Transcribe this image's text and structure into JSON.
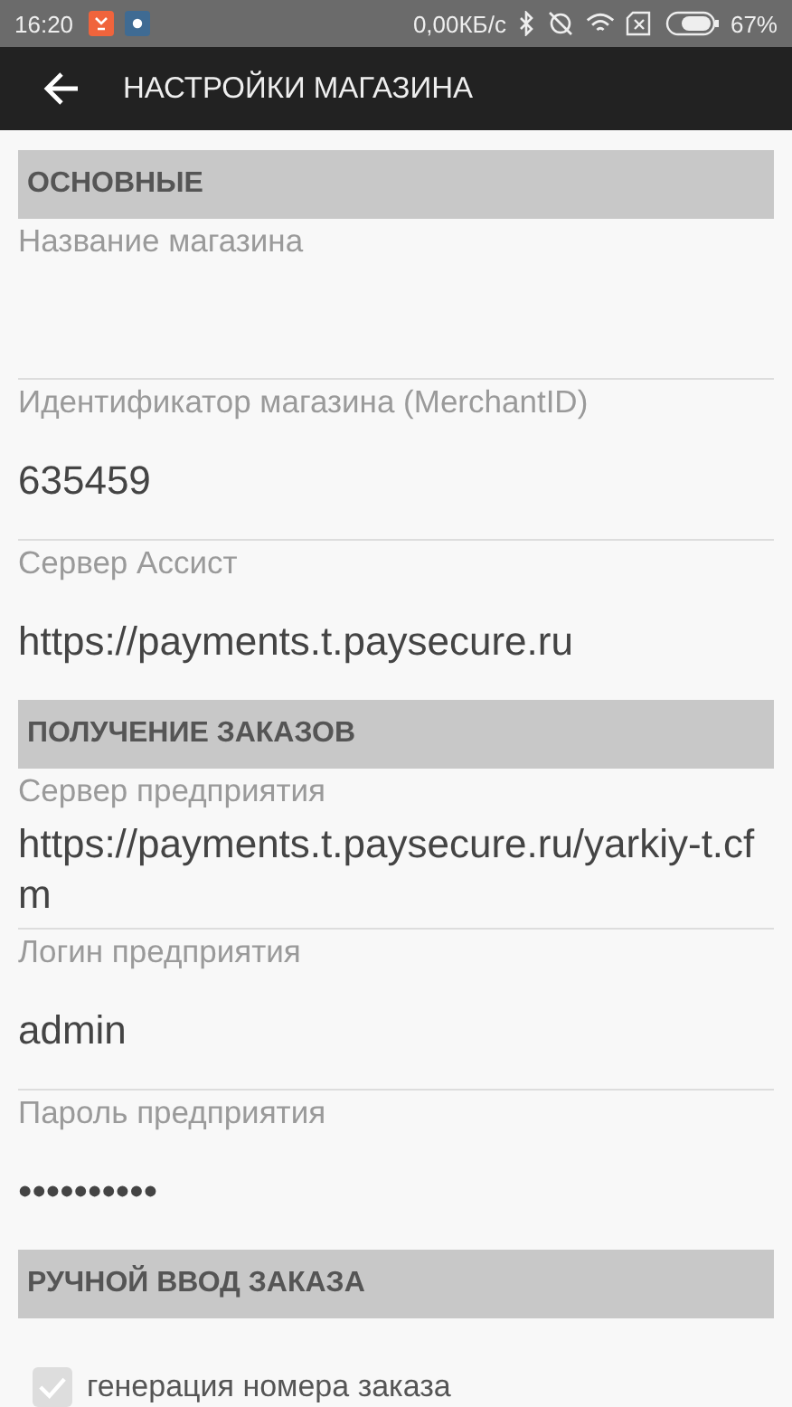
{
  "status_bar": {
    "time": "16:20",
    "speed": "0,00КБ/с",
    "battery": "67%"
  },
  "toolbar": {
    "title": "НАСТРОЙКИ МАГАЗИНА"
  },
  "sections": [
    {
      "title": "ОСНОВНЫЕ",
      "items": [
        {
          "kind": "field",
          "label": "Название магазина"
        },
        {
          "kind": "field",
          "label": "Идентификатор магазина (MerchantID)",
          "value": "635459"
        },
        {
          "kind": "field",
          "label": "Сервер Ассист",
          "value": "https://payments.t.paysecure.ru"
        }
      ]
    },
    {
      "title": "ПОЛУЧЕНИЕ ЗАКАЗОВ",
      "items": [
        {
          "kind": "field",
          "label": "Сервер предприятия",
          "value": "https://payments.t.paysecure.ru/yarkiy-t.cfm"
        },
        {
          "kind": "field",
          "label": "Логин предприятия",
          "value": "admin"
        },
        {
          "kind": "field",
          "label": "Пароль предприятия",
          "value": "••••••••••"
        }
      ]
    },
    {
      "title": "РУЧНОЙ ВВОД ЗАКАЗА",
      "items": [
        {
          "kind": "checkbox",
          "label": "генерация номера заказа",
          "checked": true,
          "disabled": true
        }
      ]
    }
  ]
}
